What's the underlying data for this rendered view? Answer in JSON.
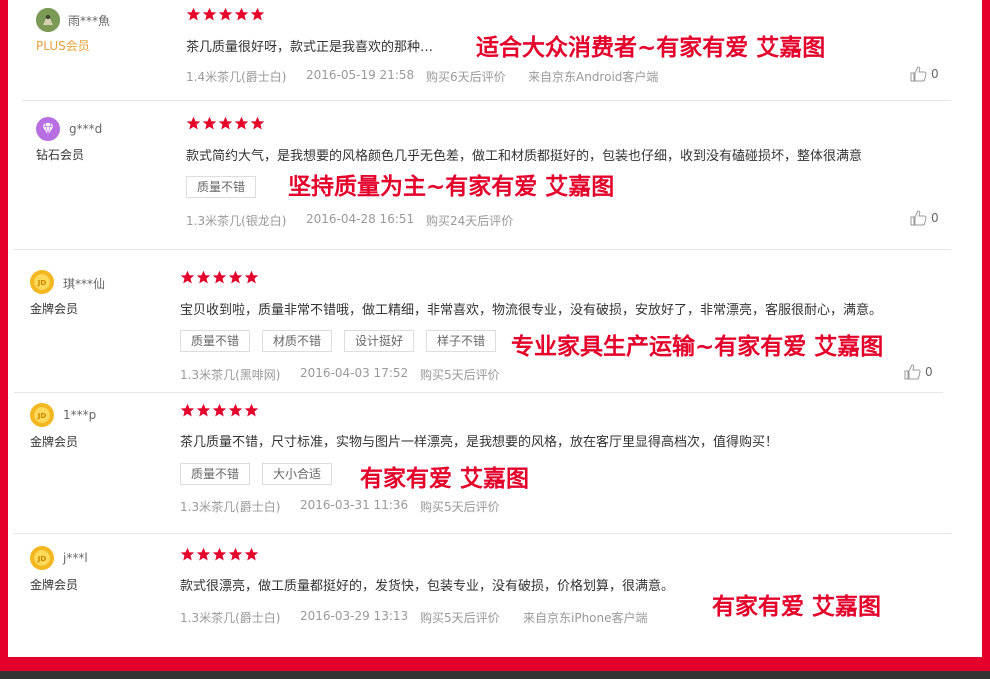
{
  "colors": {
    "frame": "#e4002b",
    "star": "#e4002b",
    "overlay_text": "#e4002b",
    "plus_level": "#e6a23c"
  },
  "reviews": [
    {
      "username": "雨***魚",
      "level": "PLUS会员",
      "avatar_icon": "user-photo-icon",
      "rating": 5,
      "content": "茶几质量很好呀，款式正是我喜欢的那种…",
      "tags": [],
      "product": "1.4米茶几(爵士白)",
      "date": "2016-05-19 21:58",
      "purchase_info": "购买6天后评价",
      "source": "来自京东Android客户端",
      "likes": "0",
      "overlay": "适合大众消费者~有家有爱 艾嘉图"
    },
    {
      "username": "g***d",
      "level": "钻石会员",
      "avatar_icon": "diamond-member-icon",
      "rating": 5,
      "content": "款式简约大气，是我想要的风格颜色几乎无色差，做工和材质都挺好的，包装也仔细，收到没有磕碰损坏，整体很满意",
      "tags": [
        "质量不错"
      ],
      "product": "1.3米茶几(银龙白)",
      "date": "2016-04-28 16:51",
      "purchase_info": "购买24天后评价",
      "source": "",
      "likes": "0",
      "overlay": "坚持质量为主~有家有爱 艾嘉图"
    },
    {
      "username": "琪***仙",
      "level": "金牌会员",
      "avatar_icon": "gold-member-icon",
      "rating": 5,
      "content": "宝贝收到啦，质量非常不错哦，做工精细，非常喜欢，物流很专业，没有破损，安放好了，非常漂亮，客服很耐心，满意。",
      "tags": [
        "质量不错",
        "材质不错",
        "设计挺好",
        "样子不错"
      ],
      "product": "1.3米茶几(黑啡网)",
      "date": "2016-04-03 17:52",
      "purchase_info": "购买5天后评价",
      "source": "",
      "likes": "0",
      "overlay": "专业家具生产运输~有家有爱 艾嘉图"
    },
    {
      "username": "1***p",
      "level": "金牌会员",
      "avatar_icon": "gold-member-icon",
      "rating": 5,
      "content": "茶几质量不错，尺寸标准，实物与图片一样漂亮，是我想要的风格，放在客厅里显得高档次，值得购买！",
      "tags": [
        "质量不错",
        "大小合适"
      ],
      "product": "1.3米茶几(爵士白)",
      "date": "2016-03-31 11:36",
      "purchase_info": "购买5天后评价",
      "source": "",
      "likes": "",
      "overlay": "有家有爱 艾嘉图"
    },
    {
      "username": "j***l",
      "level": "金牌会员",
      "avatar_icon": "gold-member-icon",
      "rating": 5,
      "content": "款式很漂亮，做工质量都挺好的，发货快，包装专业，没有破损，价格划算，很满意。",
      "tags": [],
      "product": "1.3米茶几(爵士白)",
      "date": "2016-03-29 13:13",
      "purchase_info": "购买5天后评价",
      "source": "来自京东iPhone客户端",
      "likes": "",
      "overlay": "有家有爱 艾嘉图"
    }
  ]
}
